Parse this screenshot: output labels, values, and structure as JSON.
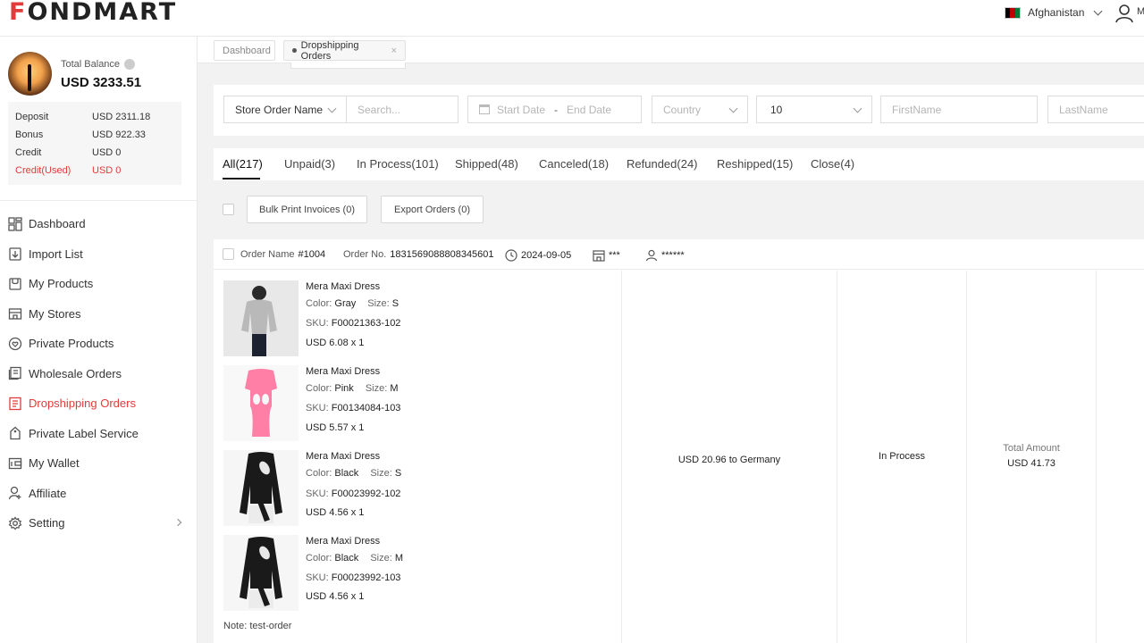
{
  "header": {
    "logo_text": "ONDMART",
    "logo_first": "F",
    "country": "Afghanistan",
    "user_trunc": "M",
    "flag_colors": [
      "#000000",
      "#be0000",
      "#007a36"
    ]
  },
  "balance": {
    "label": "Total Balance",
    "value": "USD 3233.51",
    "rows": [
      {
        "key": "Deposit",
        "value": "USD 2311.18"
      },
      {
        "key": "Bonus",
        "value": "USD 922.33"
      },
      {
        "key": "Credit",
        "value": "USD 0"
      },
      {
        "key": "Credit(Used)",
        "value": "USD 0"
      }
    ]
  },
  "nav": [
    {
      "label": "Dashboard",
      "icon": "dashboard-icon"
    },
    {
      "label": "Import List",
      "icon": "import-icon"
    },
    {
      "label": "My Products",
      "icon": "products-icon"
    },
    {
      "label": "My Stores",
      "icon": "store-icon"
    },
    {
      "label": "Private Products",
      "icon": "heart-icon"
    },
    {
      "label": "Wholesale Orders",
      "icon": "wholesale-icon"
    },
    {
      "label": "Dropshipping Orders",
      "icon": "orders-icon"
    },
    {
      "label": "Private Label Service",
      "icon": "label-icon"
    },
    {
      "label": "My Wallet",
      "icon": "wallet-icon"
    },
    {
      "label": "Affiliate",
      "icon": "affiliate-icon"
    },
    {
      "label": "Setting",
      "icon": "gear-icon"
    }
  ],
  "page_tabs": [
    {
      "label": "Dashboard"
    },
    {
      "label": "Dropshipping Orders",
      "close": "×"
    }
  ],
  "filters": {
    "store_order_name": "Store Order Name",
    "search_placeholder": "Search...",
    "start_date": "Start Date",
    "date_sep": "-",
    "end_date": "End Date",
    "country_placeholder": "Country",
    "page_size": "10",
    "firstname_placeholder": "FirstName",
    "lastname_placeholder": "LastName"
  },
  "status_tabs": [
    "All(217)",
    "Unpaid(3)",
    "In Process(101)",
    "Shipped(48)",
    "Canceled(18)",
    "Refunded(24)",
    "Reshipped(15)",
    "Close(4)"
  ],
  "actions": {
    "bulk_print": "Bulk Print Invoices (0)",
    "export": "Export Orders (0)"
  },
  "order": {
    "name_label": "Order Name",
    "name": "#1004",
    "no_label": "Order No.",
    "no": "1831569088808345601",
    "date": "2024-09-05",
    "store": "***",
    "customer": "******",
    "products": [
      {
        "title": "Mera Maxi Dress",
        "color": "Gray",
        "size": "S",
        "sku": "F00021363-102",
        "price": "USD 6.08 x 1",
        "swatch": "#b9b9b9"
      },
      {
        "title": "Mera Maxi Dress",
        "color": "Pink",
        "size": "M",
        "sku": "F00134084-103",
        "price": "USD 5.57 x 1",
        "swatch": "#ff7fa6"
      },
      {
        "title": "Mera Maxi Dress",
        "color": "Black",
        "size": "S",
        "sku": "F00023992-102",
        "price": "USD 4.56 x 1",
        "swatch": "#1a1a1a"
      },
      {
        "title": "Mera Maxi Dress",
        "color": "Black",
        "size": "M",
        "sku": "F00023992-103",
        "price": "USD 4.56 x 1",
        "swatch": "#1a1a1a"
      }
    ],
    "labels": {
      "color": "Color:",
      "size": "Size:",
      "sku": "SKU:"
    },
    "shipping": "USD 20.96 to Germany",
    "status": "In Process",
    "total_label": "Total Amount",
    "total": "USD 41.73",
    "note": "Note: test-order"
  },
  "colors": {
    "accent": "#e23b3b"
  }
}
